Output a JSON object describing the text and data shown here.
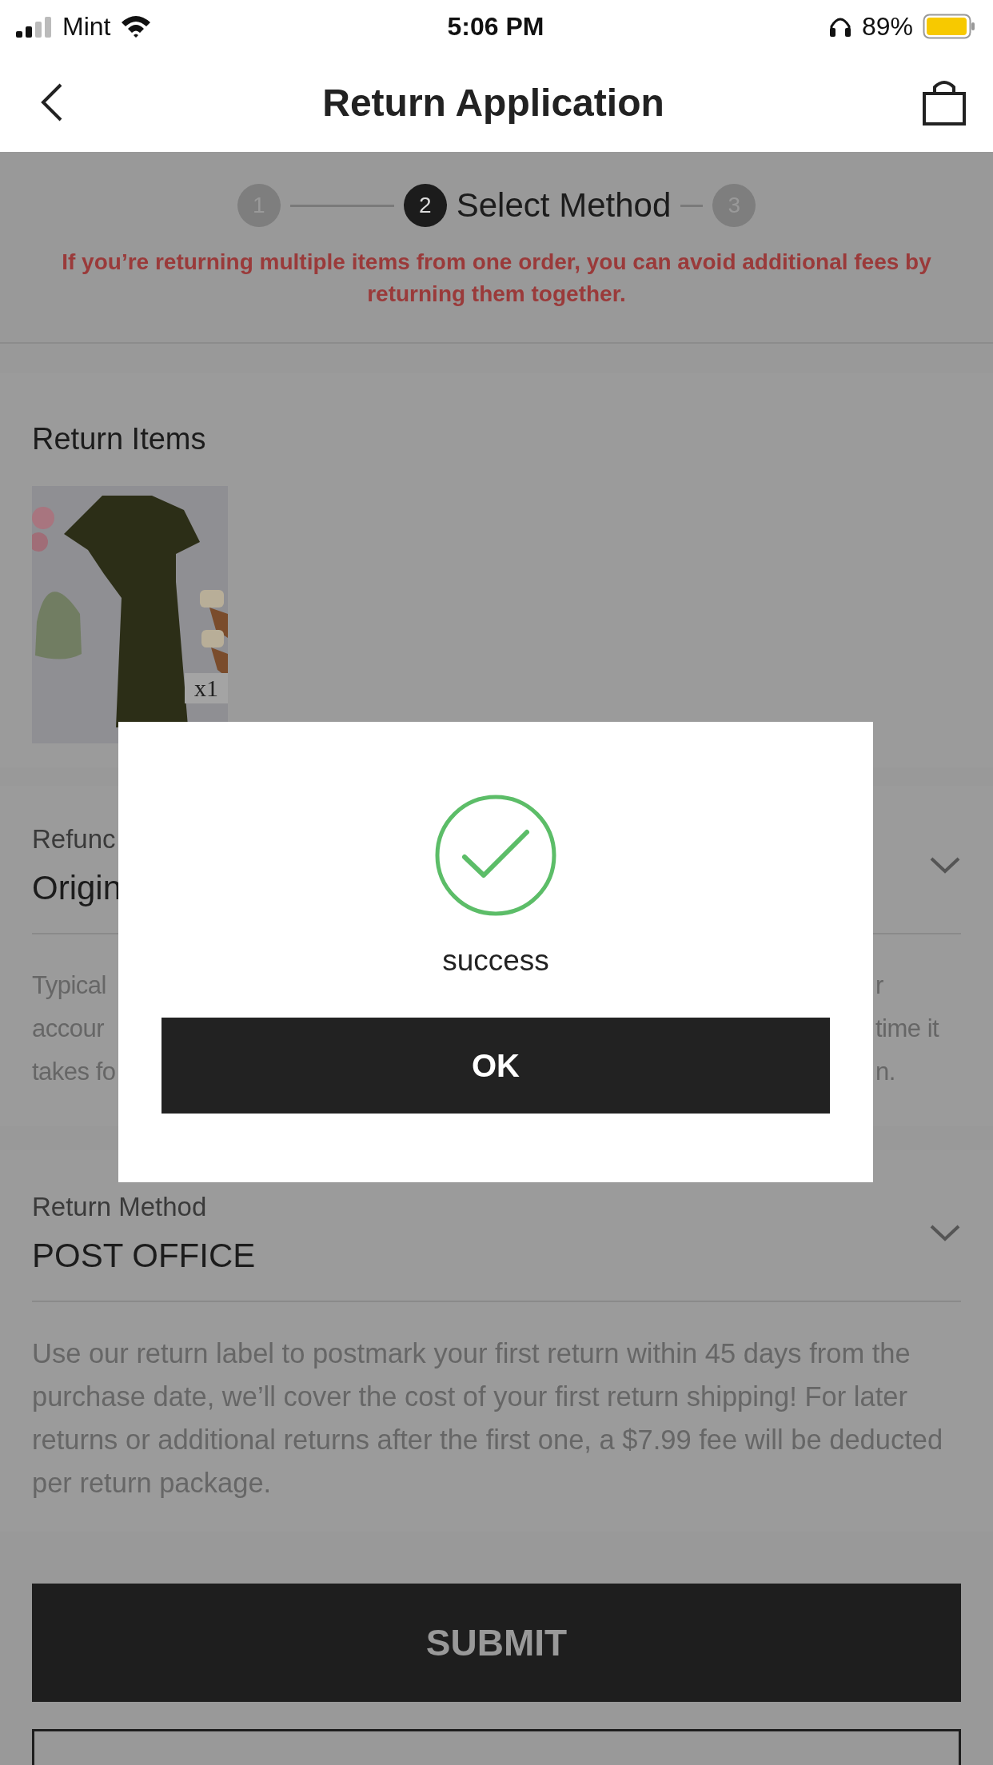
{
  "status_bar": {
    "carrier": "Mint",
    "time": "5:06 PM",
    "battery": "89%"
  },
  "header": {
    "title": "Return Application"
  },
  "stepper": {
    "steps": [
      {
        "number": "1",
        "selected": false
      },
      {
        "number": "2",
        "label": "Select Method",
        "selected": true
      },
      {
        "number": "3",
        "selected": false
      }
    ]
  },
  "notice": "If you’re returning multiple items from one order, you can avoid additional fees by returning them together.",
  "return_items": {
    "title": "Return Items",
    "items": [
      {
        "kind": "picture",
        "quantity": "x1"
      }
    ]
  },
  "refund": {
    "label": "Refunc",
    "value": "Origin",
    "description_lines": [
      {
        "left": "Typical",
        "right": "r"
      },
      {
        "left": "accour",
        "right": "time it"
      },
      {
        "left": "takes fo",
        "right": "n."
      }
    ]
  },
  "return_method": {
    "label": "Return Method",
    "value": "POST OFFICE",
    "description": "Use our return label to postmark your first return within 45 days from the purchase date, we’ll cover the cost of your first return shipping! For later returns or additional returns after the first one, a $7.99 fee will be deducted per return package."
  },
  "submit": "SUBMIT",
  "dialog": {
    "message": "success",
    "button": "OK"
  }
}
